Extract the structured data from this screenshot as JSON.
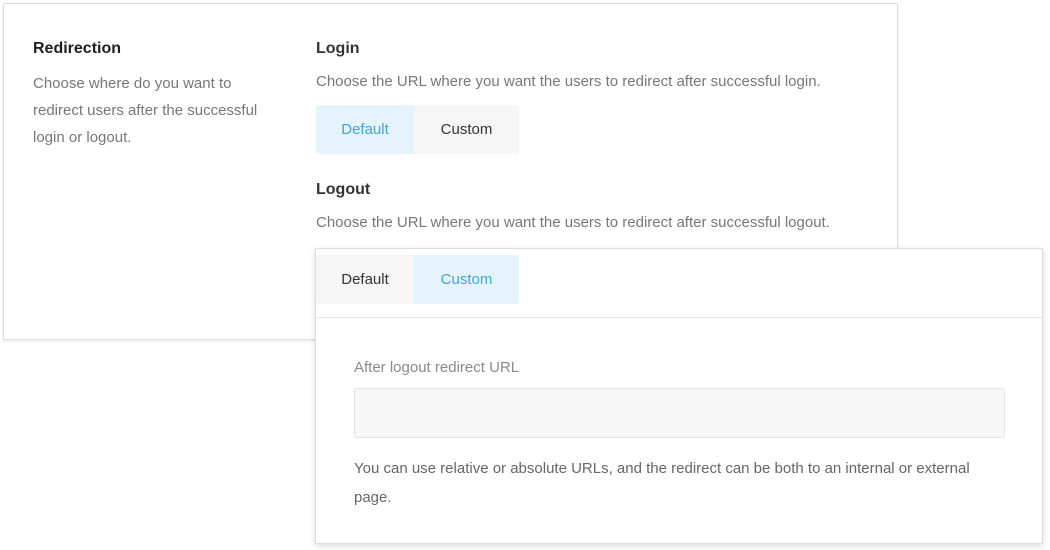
{
  "redirection": {
    "title": "Redirection",
    "description": "Choose where do you want to redirect users after the successful login or logout."
  },
  "login": {
    "title": "Login",
    "description": "Choose the URL where you want the users to redirect after successful login.",
    "toggle": {
      "default_label": "Default",
      "custom_label": "Custom",
      "selected": "Default"
    }
  },
  "logout": {
    "title": "Logout",
    "description": "Choose the URL where you want the users to redirect after successful logout.",
    "toggle": {
      "default_label": "Default",
      "custom_label": "Custom",
      "selected": "Custom"
    },
    "custom": {
      "field_label": "After logout redirect URL",
      "field_value": "",
      "help_text": "You can use relative or absolute URLs, and the redirect can be both to an internal or external page."
    }
  },
  "colors": {
    "active_bg": "#e5f4fc",
    "active_text": "#3fa7d8",
    "inactive_bg": "#f6f6f6"
  }
}
